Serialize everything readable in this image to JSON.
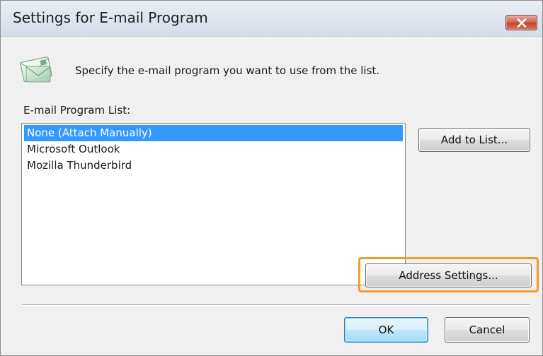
{
  "window": {
    "title": "Settings for E-mail Program",
    "close_icon": "close-icon"
  },
  "header": {
    "icon": "email-program-icon",
    "instruction": "Specify the e-mail program you want to use from the list."
  },
  "program_list": {
    "label": "E-mail Program List:",
    "items": [
      {
        "label": "None (Attach Manually)",
        "selected": true
      },
      {
        "label": "Microsoft Outlook",
        "selected": false
      },
      {
        "label": "Mozilla Thunderbird",
        "selected": false
      }
    ]
  },
  "buttons": {
    "add_to_list": "Add to List...",
    "address_settings": "Address Settings...",
    "ok": "OK",
    "cancel": "Cancel"
  },
  "colors": {
    "selection": "#3399ff",
    "highlight_outline": "#f39c2a"
  }
}
